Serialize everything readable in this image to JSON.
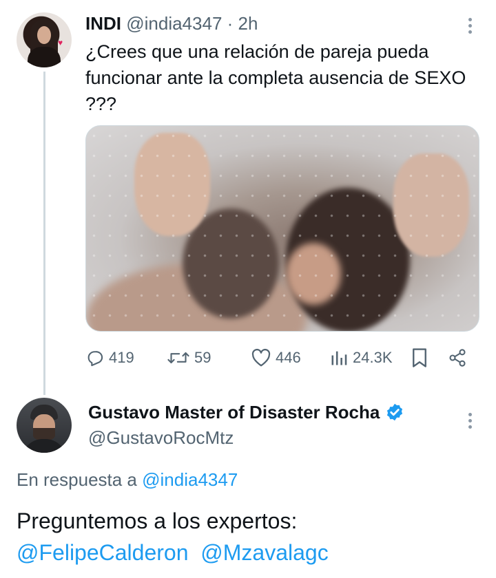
{
  "tweet": {
    "author_name": "INDI",
    "handle": "@india4347",
    "separator": "·",
    "time": "2h",
    "text": "¿Crees que una relación de pareja pueda funcionar ante la completa ausencia de SEXO ???",
    "stats": {
      "replies": "419",
      "retweets": "59",
      "likes": "446",
      "views": "24.3K"
    }
  },
  "reply": {
    "author_name": "Gustavo Master of Disaster Rocha",
    "verified": true,
    "handle": "@GustavoRocMtz",
    "reply_prefix": "En respuesta a",
    "reply_to_handle": "@india4347",
    "text": "Preguntemos a los expertos:",
    "mention_1": "@FelipeCalderon",
    "mention_2": "@Mzavalagc"
  },
  "colors": {
    "link": "#1d9bf0",
    "secondary_text": "#536471",
    "thread_line": "#cfd9de",
    "verified_badge": "#1d9bf0"
  },
  "icons": [
    "more-icon",
    "reply-icon",
    "retweet-icon",
    "like-icon",
    "views-icon",
    "bookmark-icon",
    "share-icon",
    "verified-icon"
  ]
}
